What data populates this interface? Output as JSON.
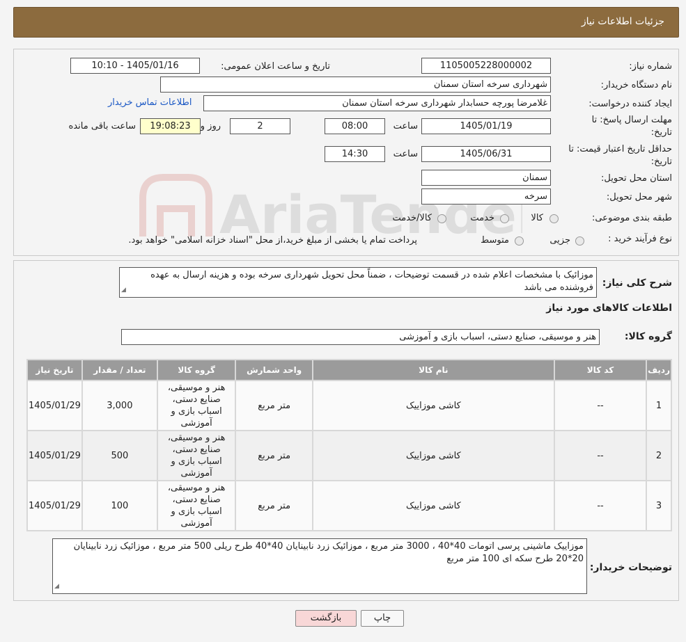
{
  "header": {
    "title": "جزئیات اطلاعات نیاز"
  },
  "form": {
    "need_number_label": "شماره نیاز:",
    "need_number_value": "1105005228000002",
    "announce_label": "تاریخ و ساعت اعلان عمومی:",
    "announce_value": "1405/01/16 - 10:10",
    "buyer_org_label": "نام دستگاه خریدار:",
    "buyer_org_value": "شهرداری سرخه استان سمنان",
    "creator_label": "ایجاد کننده درخواست:",
    "creator_value": "غلامرضا پورچه حسابدار شهرداری سرخه استان سمنان",
    "contact_link": "اطلاعات تماس خریدار",
    "deadline_label_1": "مهلت ارسال پاسخ: تا",
    "deadline_label_2": "تاریخ:",
    "deadline_date": "1405/01/19",
    "time_label": "ساعت",
    "deadline_time": "08:00",
    "days_value": "2",
    "days_label": "روز و",
    "remaining_value": "19:08:23",
    "remaining_label": "ساعت باقی مانده",
    "validity_label_1": "حداقل تاریخ اعتبار قیمت: تا",
    "validity_label_2": "تاریخ:",
    "validity_date": "1405/06/31",
    "validity_time": "14:30",
    "province_label": "استان محل تحویل:",
    "province_value": "سمنان",
    "city_label": "شهر محل تحویل:",
    "city_value": "سرخه",
    "category_label": "طبقه بندی موضوعی:",
    "category_opt1": "کالا",
    "category_opt2": "خدمت",
    "category_opt3": "کالا/خدمت",
    "process_label": "نوع فرآیند خرید :",
    "process_opt1": "جزیی",
    "process_opt2": "متوسط",
    "process_note": "پرداخت تمام یا بخشی از مبلغ خرید،از محل \"اسناد خزانه اسلامی\" خواهد بود."
  },
  "description": {
    "label": "شرح کلی نیاز:",
    "text": "موزائیک با مشخصات اعلام شده در قسمت توضیحات ، ضمناً محل تحویل شهرداری سرخه بوده و هزینه ارسال به عهده فروشنده می باشد"
  },
  "goods": {
    "section_title": "اطلاعات کالاهای مورد نیاز",
    "group_label": "گروه کالا:",
    "group_value": "هنر و موسیقی، صنایع دستی، اسباب بازی و آموزشی",
    "columns": [
      "ردیف",
      "کد کالا",
      "نام کالا",
      "واحد شمارش",
      "گروه کالا",
      "تعداد / مقدار",
      "تاریخ نیاز"
    ],
    "rows": [
      {
        "idx": "1",
        "code": "--",
        "name": "کاشی موزاییک",
        "unit": "متر مربع",
        "group": "هنر و موسیقی، صنایع دستی، اسباب بازی و آموزشی",
        "qty": "3,000",
        "date": "1405/01/29"
      },
      {
        "idx": "2",
        "code": "--",
        "name": "کاشی موزاییک",
        "unit": "متر مربع",
        "group": "هنر و موسیقی، صنایع دستی، اسباب بازی و آموزشی",
        "qty": "500",
        "date": "1405/01/29"
      },
      {
        "idx": "3",
        "code": "--",
        "name": "کاشی موزاییک",
        "unit": "متر مربع",
        "group": "هنر و موسیقی، صنایع دستی، اسباب بازی و آموزشی",
        "qty": "100",
        "date": "1405/01/29"
      }
    ]
  },
  "buyer_notes": {
    "label": "توضیحات خریدار:",
    "text": "موزاییک ماشینی پرسی اتومات 40*40 ، 3000 متر مربع ، موزائیک زرد نابینایان 40*40 طرح ریلی 500 متر مربع ، موزائیک زرد نابینایان 20*20 طرح سکه ای 100 متر مربع"
  },
  "buttons": {
    "print": "چاپ",
    "back": "بازگشت"
  },
  "watermark": {
    "text": "AriaTender.neT"
  },
  "colors": {
    "header": "#8c6b3e",
    "link": "#1a57c4",
    "back_button": "#f8d7d7"
  }
}
